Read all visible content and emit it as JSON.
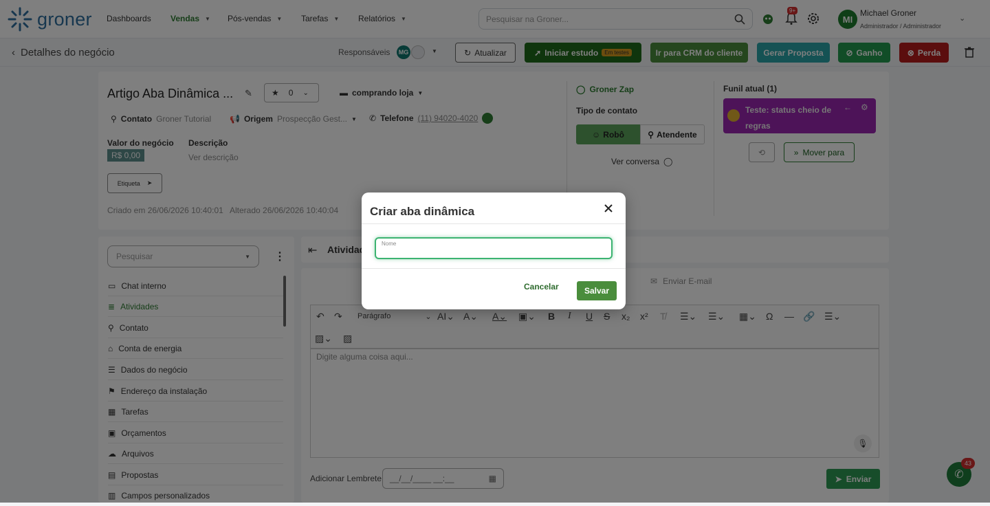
{
  "nav": {
    "logo": "groner",
    "items": [
      "Dashboards",
      "Vendas",
      "Pós-vendas",
      "Tarefas",
      "Relatórios"
    ],
    "search_placeholder": "Pesquisar na Groner...",
    "notif_badge": "9+",
    "user_initials": "MI",
    "user_name": "Michael Groner",
    "user_role": "Administrador / Administrador"
  },
  "subbar": {
    "back_label": "Detalhes do negócio",
    "responsaveis": "Responsáveis",
    "resp_initials": "MG",
    "atualizar": "Atualizar",
    "iniciar_estudo": "Iniciar estudo",
    "em_testes": "Em testes",
    "crm": "Ir para CRM do cliente",
    "gerar_proposta": "Gerar Proposta",
    "ganho": "Ganho",
    "perda": "Perda"
  },
  "deal": {
    "title": "Artigo Aba Dinâmica ...",
    "rating": "0",
    "stage": "comprando loja",
    "contato_label": "Contato",
    "contato_value": "Groner Tutorial",
    "origem_label": "Origem",
    "origem_value": "Prospecção Gest...",
    "telefone_label": "Telefone",
    "telefone_value": "(11) 94020-4020",
    "valor_label": "Valor do negócio",
    "valor_value": "R$ 0,00",
    "descricao_label": "Descrição",
    "descricao_value": "Ver descrição",
    "etiqueta": "Etiqueta",
    "criado": "Criado em 26/06/2026 10:40:01",
    "alterado": "Alterado 26/06/2026 10:40:04"
  },
  "zap": {
    "title": "Groner Zap",
    "tipo_label": "Tipo de contato",
    "robo": "Robô",
    "atendente": "Atendente",
    "ver_conversa": "Ver conversa"
  },
  "funil": {
    "title": "Funil atual (1)",
    "status": "Teste: status cheio de regras",
    "mover": "Mover para"
  },
  "sidebar": {
    "search_placeholder": "Pesquisar",
    "items": [
      "Chat interno",
      "Atividades",
      "Contato",
      "Conta de energia",
      "Dados do negócio",
      "Endereço da instalação",
      "Tarefas",
      "Orçamentos",
      "Arquivos",
      "Propostas",
      "Campos personalizados"
    ]
  },
  "activity": {
    "title": "Atividades",
    "enviar_email": "Enviar E-mail",
    "paragrafo": "Parágrafo",
    "editor_placeholder": "Digite alguma coisa aqui...",
    "lembrete_label": "Adicionar Lembrete",
    "lembrete_placeholder": "__/__/____ __:__",
    "enviar": "Enviar"
  },
  "whatsapp_badge": "43",
  "modal": {
    "title": "Criar aba dinâmica",
    "field_label": "Nome",
    "field_value": "",
    "cancel": "Cancelar",
    "save": "Salvar"
  }
}
